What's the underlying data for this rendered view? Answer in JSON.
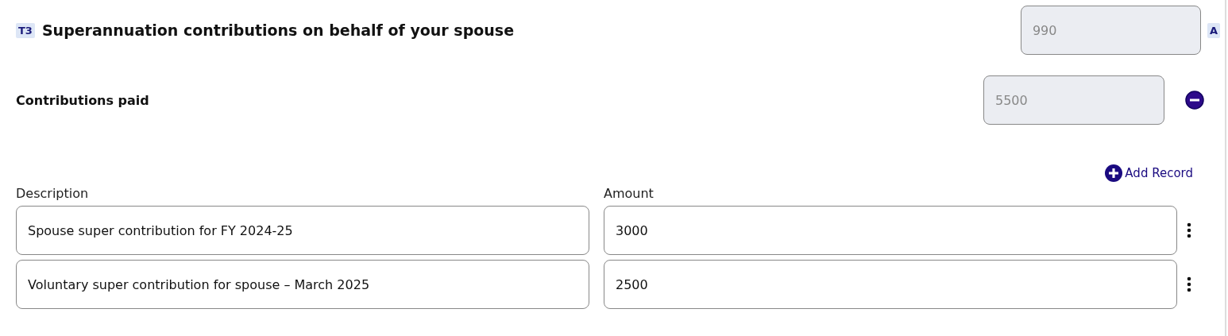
{
  "section": {
    "badge": "T3",
    "title": "Superannuation contributions on behalf of your spouse",
    "total": {
      "value": "990",
      "disabled": true
    },
    "total_badge": "A"
  },
  "contributions": {
    "label": "Contributions paid",
    "field": {
      "value": "5500",
      "disabled": true
    },
    "expanded": true
  },
  "add_record": "Add Record",
  "columns": [
    "Description",
    "Amount"
  ],
  "records": [
    {
      "description": "Spouse super contribution for FY 2024-25",
      "amount": "3000"
    },
    {
      "description": "Voluntary super contribution for spouse – March 2025",
      "amount": "2500"
    }
  ]
}
